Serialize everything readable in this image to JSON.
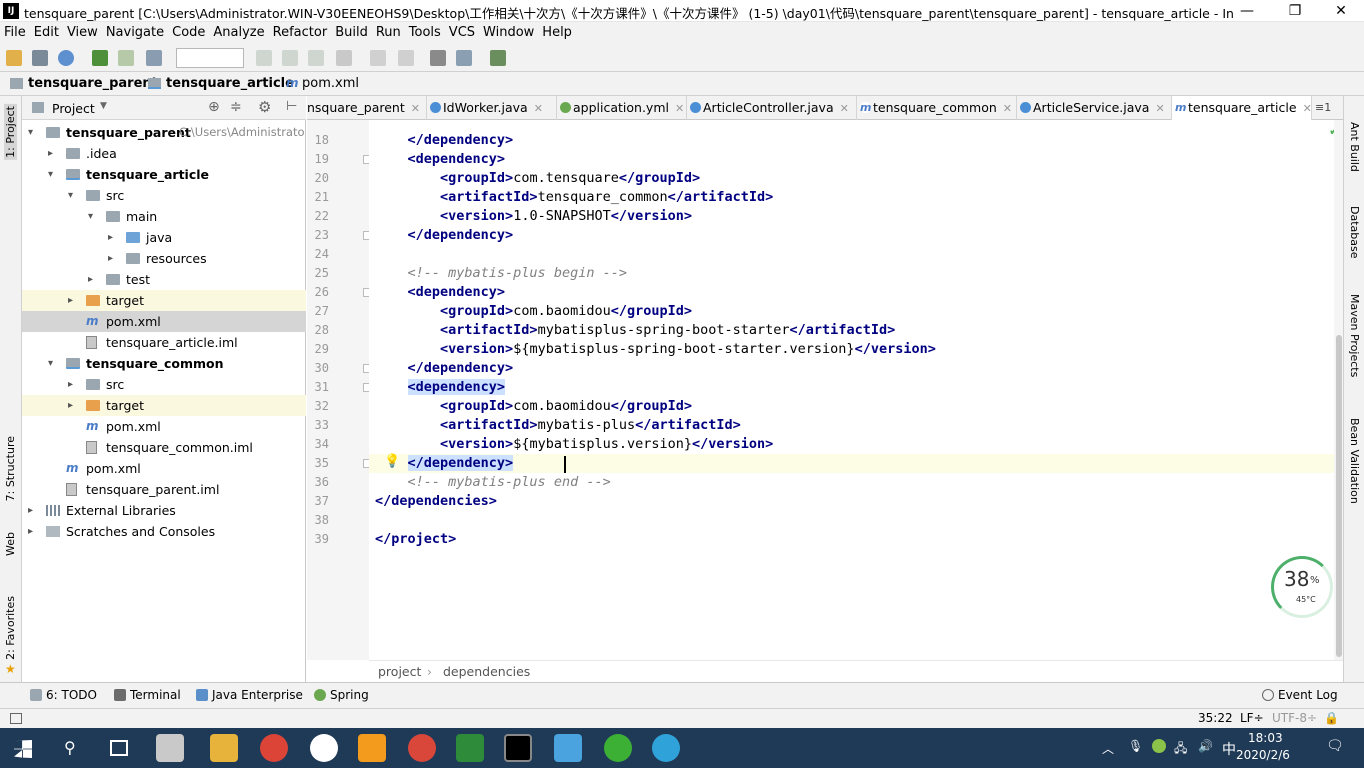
{
  "window": {
    "title": "tensquare_parent [C:\\Users\\Administrator.WIN-V30EENEOHS9\\Desktop\\工作相关\\十次方\\《十次方课件》\\《十次方课件》 (1-5) \\day01\\代码\\tensquare_parent\\tensquare_parent] - tensquare_article - IntelliJ ID...",
    "app_icon": "IJ",
    "minimize": "—",
    "maximize": "❐",
    "close": "✕"
  },
  "menu": [
    "File",
    "Edit",
    "View",
    "Navigate",
    "Code",
    "Analyze",
    "Refactor",
    "Build",
    "Run",
    "Tools",
    "VCS",
    "Window",
    "Help"
  ],
  "navbar": {
    "crumbs": [
      "tensquare_parent",
      "tensquare_article",
      "pom.xml"
    ]
  },
  "project_panel": {
    "title": "Project",
    "tree": [
      {
        "label": "tensquare_parent",
        "hint": "C:\\Users\\Administrato",
        "bold": true
      },
      {
        "label": ".idea"
      },
      {
        "label": "tensquare_article",
        "bold": true
      },
      {
        "label": "src"
      },
      {
        "label": "main"
      },
      {
        "label": "java"
      },
      {
        "label": "resources"
      },
      {
        "label": "test"
      },
      {
        "label": "target"
      },
      {
        "label": "pom.xml"
      },
      {
        "label": "tensquare_article.iml"
      },
      {
        "label": "tensquare_common",
        "bold": true
      },
      {
        "label": "src"
      },
      {
        "label": "target"
      },
      {
        "label": "pom.xml"
      },
      {
        "label": "tensquare_common.iml"
      },
      {
        "label": "pom.xml"
      },
      {
        "label": "tensquare_parent.iml"
      },
      {
        "label": "External Libraries"
      },
      {
        "label": "Scratches and Consoles"
      }
    ]
  },
  "tabs": [
    {
      "label": "nsquare_parent"
    },
    {
      "label": "IdWorker.java"
    },
    {
      "label": "application.yml"
    },
    {
      "label": "ArticleController.java"
    },
    {
      "label": "tensquare_common"
    },
    {
      "label": "ArticleService.java"
    },
    {
      "label": "tensquare_article"
    }
  ],
  "tab_overflow": "≡1",
  "editor": {
    "lines": [
      {
        "n": "18",
        "parts": [
          [
            "    ",
            "txt"
          ],
          [
            "</dependency>",
            "tag"
          ]
        ]
      },
      {
        "n": "19",
        "parts": [
          [
            "    ",
            "txt"
          ],
          [
            "<dependency>",
            "tag"
          ]
        ]
      },
      {
        "n": "20",
        "parts": [
          [
            "        ",
            "txt"
          ],
          [
            "<groupId>",
            "tag"
          ],
          [
            "com.tensquare",
            "txt"
          ],
          [
            "</groupId>",
            "tag"
          ]
        ]
      },
      {
        "n": "21",
        "parts": [
          [
            "        ",
            "txt"
          ],
          [
            "<artifactId>",
            "tag"
          ],
          [
            "tensquare_common",
            "txt"
          ],
          [
            "</artifactId>",
            "tag"
          ]
        ]
      },
      {
        "n": "22",
        "parts": [
          [
            "        ",
            "txt"
          ],
          [
            "<version>",
            "tag"
          ],
          [
            "1.0-SNAPSHOT",
            "txt"
          ],
          [
            "</version>",
            "tag"
          ]
        ]
      },
      {
        "n": "23",
        "parts": [
          [
            "    ",
            "txt"
          ],
          [
            "</dependency>",
            "tag"
          ]
        ]
      },
      {
        "n": "24",
        "parts": []
      },
      {
        "n": "25",
        "parts": [
          [
            "    ",
            "txt"
          ],
          [
            "<!-- mybatis-plus begin -->",
            "cmt"
          ]
        ]
      },
      {
        "n": "26",
        "parts": [
          [
            "    ",
            "txt"
          ],
          [
            "<dependency>",
            "tag"
          ]
        ]
      },
      {
        "n": "27",
        "parts": [
          [
            "        ",
            "txt"
          ],
          [
            "<groupId>",
            "tag"
          ],
          [
            "com.baomidou",
            "txt"
          ],
          [
            "</groupId>",
            "tag"
          ]
        ]
      },
      {
        "n": "28",
        "parts": [
          [
            "        ",
            "txt"
          ],
          [
            "<artifactId>",
            "tag"
          ],
          [
            "mybatisplus-spring-boot-starter",
            "txt"
          ],
          [
            "</artifactId>",
            "tag"
          ]
        ]
      },
      {
        "n": "29",
        "parts": [
          [
            "        ",
            "txt"
          ],
          [
            "<version>",
            "tag"
          ],
          [
            "${mybatisplus-spring-boot-starter.version}",
            "txt"
          ],
          [
            "</version>",
            "tag"
          ]
        ]
      },
      {
        "n": "30",
        "parts": [
          [
            "    ",
            "txt"
          ],
          [
            "</dependency>",
            "tag"
          ]
        ]
      },
      {
        "n": "31",
        "parts": [
          [
            "    ",
            "txt"
          ],
          [
            "<dependency>",
            "tag hl"
          ]
        ]
      },
      {
        "n": "32",
        "parts": [
          [
            "        ",
            "txt"
          ],
          [
            "<groupId>",
            "tag"
          ],
          [
            "com.baomidou",
            "txt"
          ],
          [
            "</groupId>",
            "tag"
          ]
        ]
      },
      {
        "n": "33",
        "parts": [
          [
            "        ",
            "txt"
          ],
          [
            "<artifactId>",
            "tag"
          ],
          [
            "mybatis-plus",
            "txt"
          ],
          [
            "</artifactId>",
            "tag"
          ]
        ]
      },
      {
        "n": "34",
        "parts": [
          [
            "        ",
            "txt"
          ],
          [
            "<version>",
            "tag"
          ],
          [
            "${mybatisplus.version}",
            "txt"
          ],
          [
            "</version>",
            "tag"
          ]
        ]
      },
      {
        "n": "35",
        "parts": [
          [
            "    ",
            "txt"
          ],
          [
            "</dependency>",
            "tag hl"
          ]
        ]
      },
      {
        "n": "36",
        "parts": [
          [
            "    ",
            "txt"
          ],
          [
            "<!-- mybatis-plus end -->",
            "cmt"
          ]
        ]
      },
      {
        "n": "37",
        "parts": [
          [
            "",
            "txt"
          ],
          [
            "</dependencies>",
            "tag"
          ]
        ]
      },
      {
        "n": "38",
        "parts": []
      },
      {
        "n": "39",
        "parts": [
          [
            "",
            "txt"
          ],
          [
            "</project>",
            "tag"
          ]
        ]
      }
    ]
  },
  "editor_breadcrumb": [
    "project",
    "dependencies"
  ],
  "bottom_tabs": [
    "6: TODO",
    "Terminal",
    "Java Enterprise",
    "Spring"
  ],
  "event_log": "Event Log",
  "status": {
    "position": "35:22",
    "line_sep": "LF÷",
    "encoding": "UTF-8÷"
  },
  "left_stripe": [
    "1: Project",
    "7: Structure",
    "Web",
    "2: Favorites"
  ],
  "right_stripe": [
    "Ant Build",
    "Database",
    "Maven Projects",
    "Bean Validation"
  ],
  "cpu_widget": {
    "percent": "38",
    "unit": "%",
    "temp": "45°C"
  },
  "taskbar": {
    "time": "18:03",
    "date": "2020/2/6",
    "ime": "中"
  },
  "colors": {
    "tag": "#000080",
    "comment": "#808080",
    "selection": "#cce0ff",
    "taskbar": "#1f3a57"
  }
}
